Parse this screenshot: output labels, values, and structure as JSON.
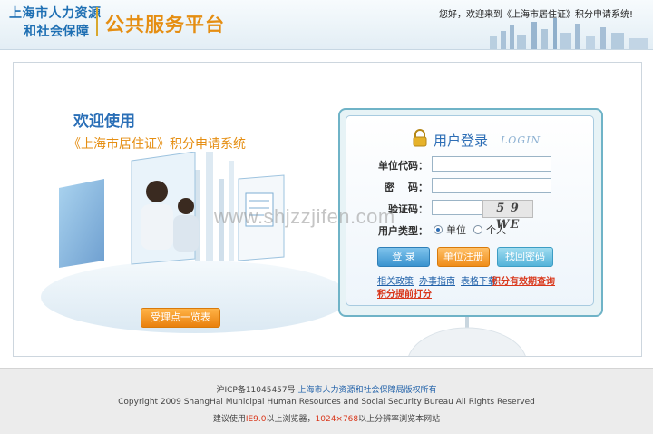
{
  "header": {
    "logo_line1": "上海市人力资源",
    "logo_line2": "和社会保障",
    "logo_platform": "公共服务平台",
    "welcome_text": "您好，欢迎来到《上海市居住证》积分申请系统!"
  },
  "promo": {
    "welcome": "欢迎使用",
    "system_name": "《上海市居住证》积分申请系统",
    "service_points_button": "受理点一览表"
  },
  "login": {
    "title": "用户登录",
    "title_en": "LOGIN",
    "unit_code_label": "单位代码：",
    "password_label": "密    码：",
    "captcha_label": "验证码：",
    "captcha_text": "5 9 WE",
    "user_type_label": "用户类型：",
    "user_type_options": [
      "单位",
      "个人"
    ],
    "user_type_selected": "单位",
    "login_button": "登 录",
    "register_button": "单位注册",
    "find_password_button": "找回密码",
    "links": {
      "policy": "相关政策",
      "guide": "办事指南",
      "download": "表格下载",
      "valid_period_query": "积分有效期查询",
      "submit_score": "积分提前打分"
    }
  },
  "watermark": "www.shjzzjifen.com",
  "footer": {
    "icp": "沪ICP备11045457号",
    "copyright_cn": "上海市人力资源和社会保障局版权所有",
    "copyright_en": "Copyright 2009 ShangHai Municipal Human Resources and Social Security Bureau All Rights Reserved",
    "browser_tip_prefix": "建议使用",
    "browser_tip_ie": "IE9.0",
    "browser_tip_mid": "以上浏览器，",
    "browser_tip_res": "1024×768",
    "browser_tip_suffix": "以上分辨率浏览本网站"
  },
  "colors": {
    "brand_blue": "#1e6fb3",
    "accent_orange": "#e58e12",
    "link_red": "#d9371b"
  }
}
